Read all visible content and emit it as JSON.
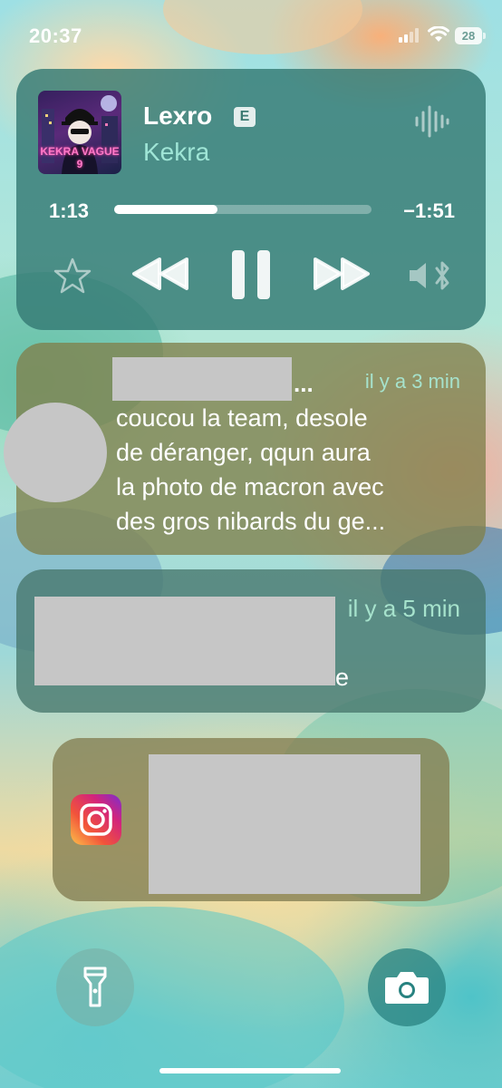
{
  "status_bar": {
    "time": "20:37",
    "battery": "28"
  },
  "now_playing": {
    "title": "Lexro",
    "explicit_badge": "E",
    "artist": "Kekra",
    "elapsed": "1:13",
    "remaining": "−1:51",
    "progress_fraction": 0.4,
    "album_art_text": "KEKRA VAGUE 9",
    "controls": [
      "star-icon",
      "rewind-icon",
      "pause-icon",
      "fast-forward-icon",
      "audio-output-icon"
    ]
  },
  "notifications": [
    {
      "time": "il y a 3 min",
      "ellipsis": "...",
      "body_lines": [
        "coucou la team, desole",
        "de déranger, qqun aura",
        "la photo de macron avec",
        "des gros nibards du ge..."
      ]
    },
    {
      "time": "il y a 5 min",
      "visible_fragment": "e"
    },
    {
      "app_icon": "instagram-icon"
    }
  ],
  "bottom": {
    "left_button": "flashlight-icon",
    "right_button": "camera-icon"
  },
  "colors": {
    "media_card": "#347a74",
    "accent_teal": "#9fe5d6",
    "redaction": "#c6c6c6"
  }
}
